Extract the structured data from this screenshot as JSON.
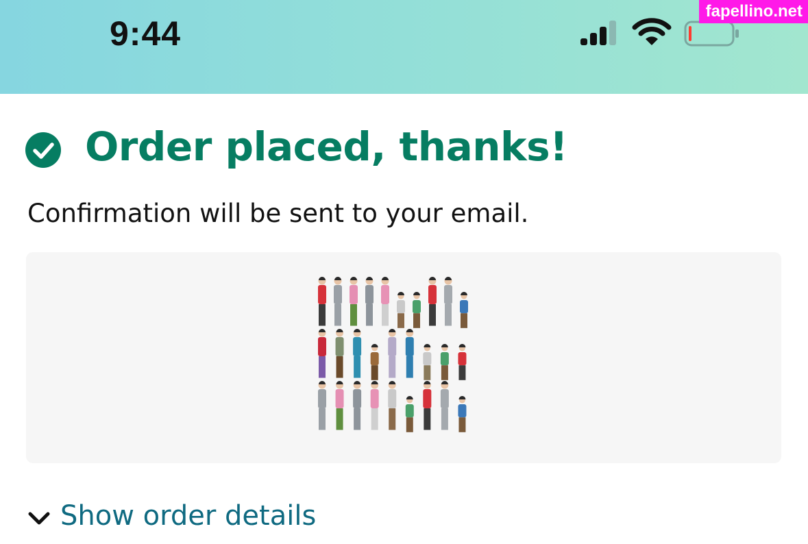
{
  "status_bar": {
    "time": "9:44",
    "watermark": "fapellino.net",
    "icons": [
      "signal-icon",
      "wifi-icon",
      "battery-icon"
    ],
    "battery_level": 0.05
  },
  "confirmation": {
    "headline": "Order placed, thanks!",
    "subline": "Confirmation will be sent to your email.",
    "check_icon": "check-circle-icon"
  },
  "product": {
    "image_icon": "product-figurines-image"
  },
  "details": {
    "link": "Show order details",
    "chevron_icon": "chevron-down-icon"
  },
  "colors": {
    "success_green": "#067d62",
    "link_teal": "#0f6a81",
    "status_gradient_start": "#86d6e0",
    "status_gradient_end": "#a2e6cf",
    "watermark_magenta": "#ff19e8"
  }
}
